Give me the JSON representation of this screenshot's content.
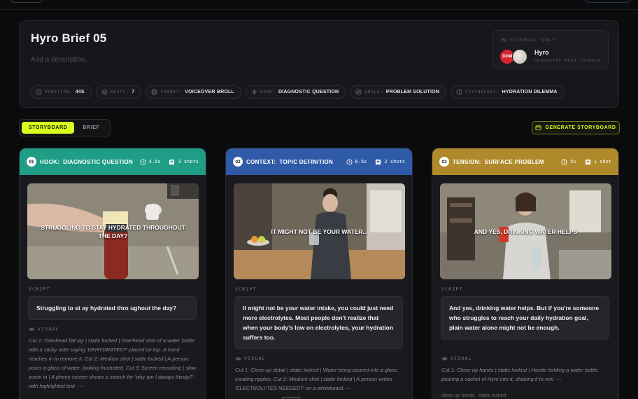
{
  "brief": {
    "title": "Hyro Brief 05",
    "description_placeholder": "Add a description...",
    "internal_label": "INTERNAL ONLY",
    "brand_name": "Hyro",
    "brand_sub": "GENERATED FROM FORMULA",
    "avatar_text": "10/48"
  },
  "meta": [
    {
      "icon": "clock-icon",
      "key": "DURATION:",
      "value": "44S"
    },
    {
      "icon": "layers-icon",
      "key": "BEATS:",
      "value": "7"
    },
    {
      "icon": "globe-icon",
      "key": "FORMAT:",
      "value": "VOICEOVER BROLL"
    },
    {
      "icon": "bolt-icon",
      "key": "HOOK:",
      "value": "DIAGNOSTIC QUESTION"
    },
    {
      "icon": "compass-icon",
      "key": "ANGLE:",
      "value": "PROBLEM SOLUTION"
    },
    {
      "icon": "brain-icon",
      "key": "PSYCHOLOGY:",
      "value": "HYDRATION DILEMMA"
    }
  ],
  "tabs": [
    {
      "label": "STORYBOARD",
      "active": true
    },
    {
      "label": "BRIEF",
      "active": false
    }
  ],
  "generate_label": "GENERATE STORYBOARD",
  "labels": {
    "script": "SCRIPT",
    "visual": "VISUAL"
  },
  "beats": [
    {
      "num": "01",
      "type": "HOOK:",
      "name": "DIAGNOSTIC QUESTION",
      "duration": "4.5s",
      "shots": "3 shots",
      "color": "#1f9d86",
      "caption": "STRUGGLING TO STAY HYDRATED THROUGHOUT THE DAY?",
      "script": "Struggling to st ay hydrated thro ughout the day?",
      "visual": "Cut 1: Overhead flat lay | static locked | Overhead shot of a water bottle with a sticky note saying 'DEHYDRATED?' placed on top. A hand reaches in to remove it. Cut 2: Medium shot | static locked | A person pours a glass of water, looking frustrated. Cut 3: Screen recording | slow zoom in | A phone screen shows a search for 'why am I always thirsty?' with highlighted text. ---"
    },
    {
      "num": "02",
      "type": "CONTEXT:",
      "name": "TOPIC DEFINITION",
      "duration": "6.5s",
      "shots": "2 shots",
      "color": "#2f5aa8",
      "caption": "IT MIGHT NOT BE YOUR WATER...",
      "script": "It might not be your water intake, you could just need more electrolytes. Most people don't realize that when your body's low on electrolytes, your hydration suffers too.",
      "visual": "Cut 1: Close-up detail | static locked | Water being poured into a glass, creating ripples. Cut 2: Medium shot | static locked | A person writes 'ELECTROLYTES NEEDED?' on a whiteboard. ---"
    },
    {
      "num": "03",
      "type": "TENSION:",
      "name": "SURFACE PROBLEM",
      "duration": "5s",
      "shots": "1 shot",
      "color": "#b08a2a",
      "caption": "AND YES, DRINKING WATER HELPS",
      "script": "And yes, drinking water helps. But if you're someone who struggles to reach your daily hydration goal, plain water alone might not be enough.",
      "visual": "Cut 1: Close-up hands | static locked | Hands holding a water bottle, pouring a sachet of Hyro into it, shaking it to mix. ---",
      "extra": "close-up hands · static locked"
    }
  ]
}
